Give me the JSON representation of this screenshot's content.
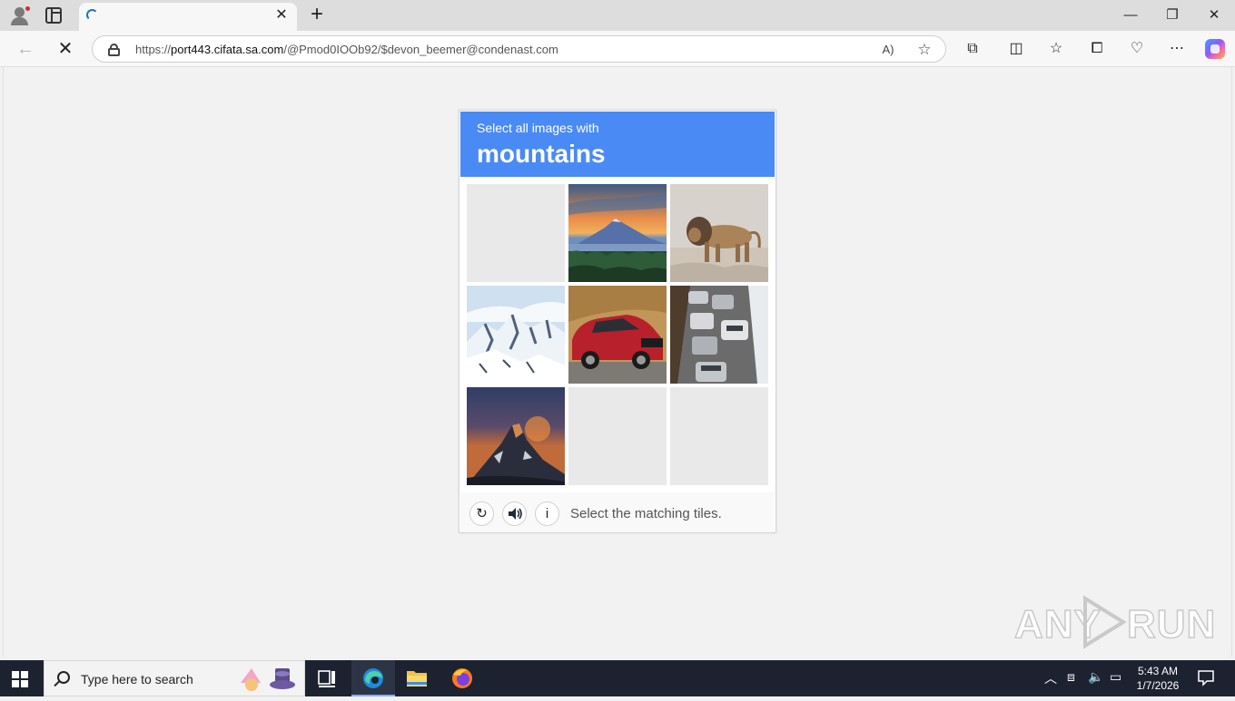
{
  "browser": {
    "tab": {
      "title": "",
      "loading": true
    },
    "address": {
      "url_prefix": "https://",
      "url_host": "port443.cifata.sa.com",
      "url_rest": "/@Pmod0IOOb92/$devon_beemer@condenast.com"
    }
  },
  "captcha": {
    "instruction": "Select all images with",
    "keyword": "mountains",
    "tiles": [
      {
        "content": "empty"
      },
      {
        "content": "mountain-at-sunset"
      },
      {
        "content": "lion"
      },
      {
        "content": "snowy-mountains"
      },
      {
        "content": "red-car"
      },
      {
        "content": "cars-in-traffic"
      },
      {
        "content": "mountain-peak-at-dusk"
      },
      {
        "content": "empty"
      },
      {
        "content": "empty"
      }
    ],
    "footer_message": "Select the matching tiles.",
    "info_label": "i"
  },
  "watermark": {
    "text_left": "ANY",
    "text_right": "RUN"
  },
  "taskbar": {
    "search_placeholder": "Type here to search",
    "time": "5:43 AM",
    "date": "1/7/2026"
  },
  "colors": {
    "captcha_header": "#4a8af4",
    "taskbar": "#1c2230",
    "edge_accent": "#1a73c8"
  }
}
